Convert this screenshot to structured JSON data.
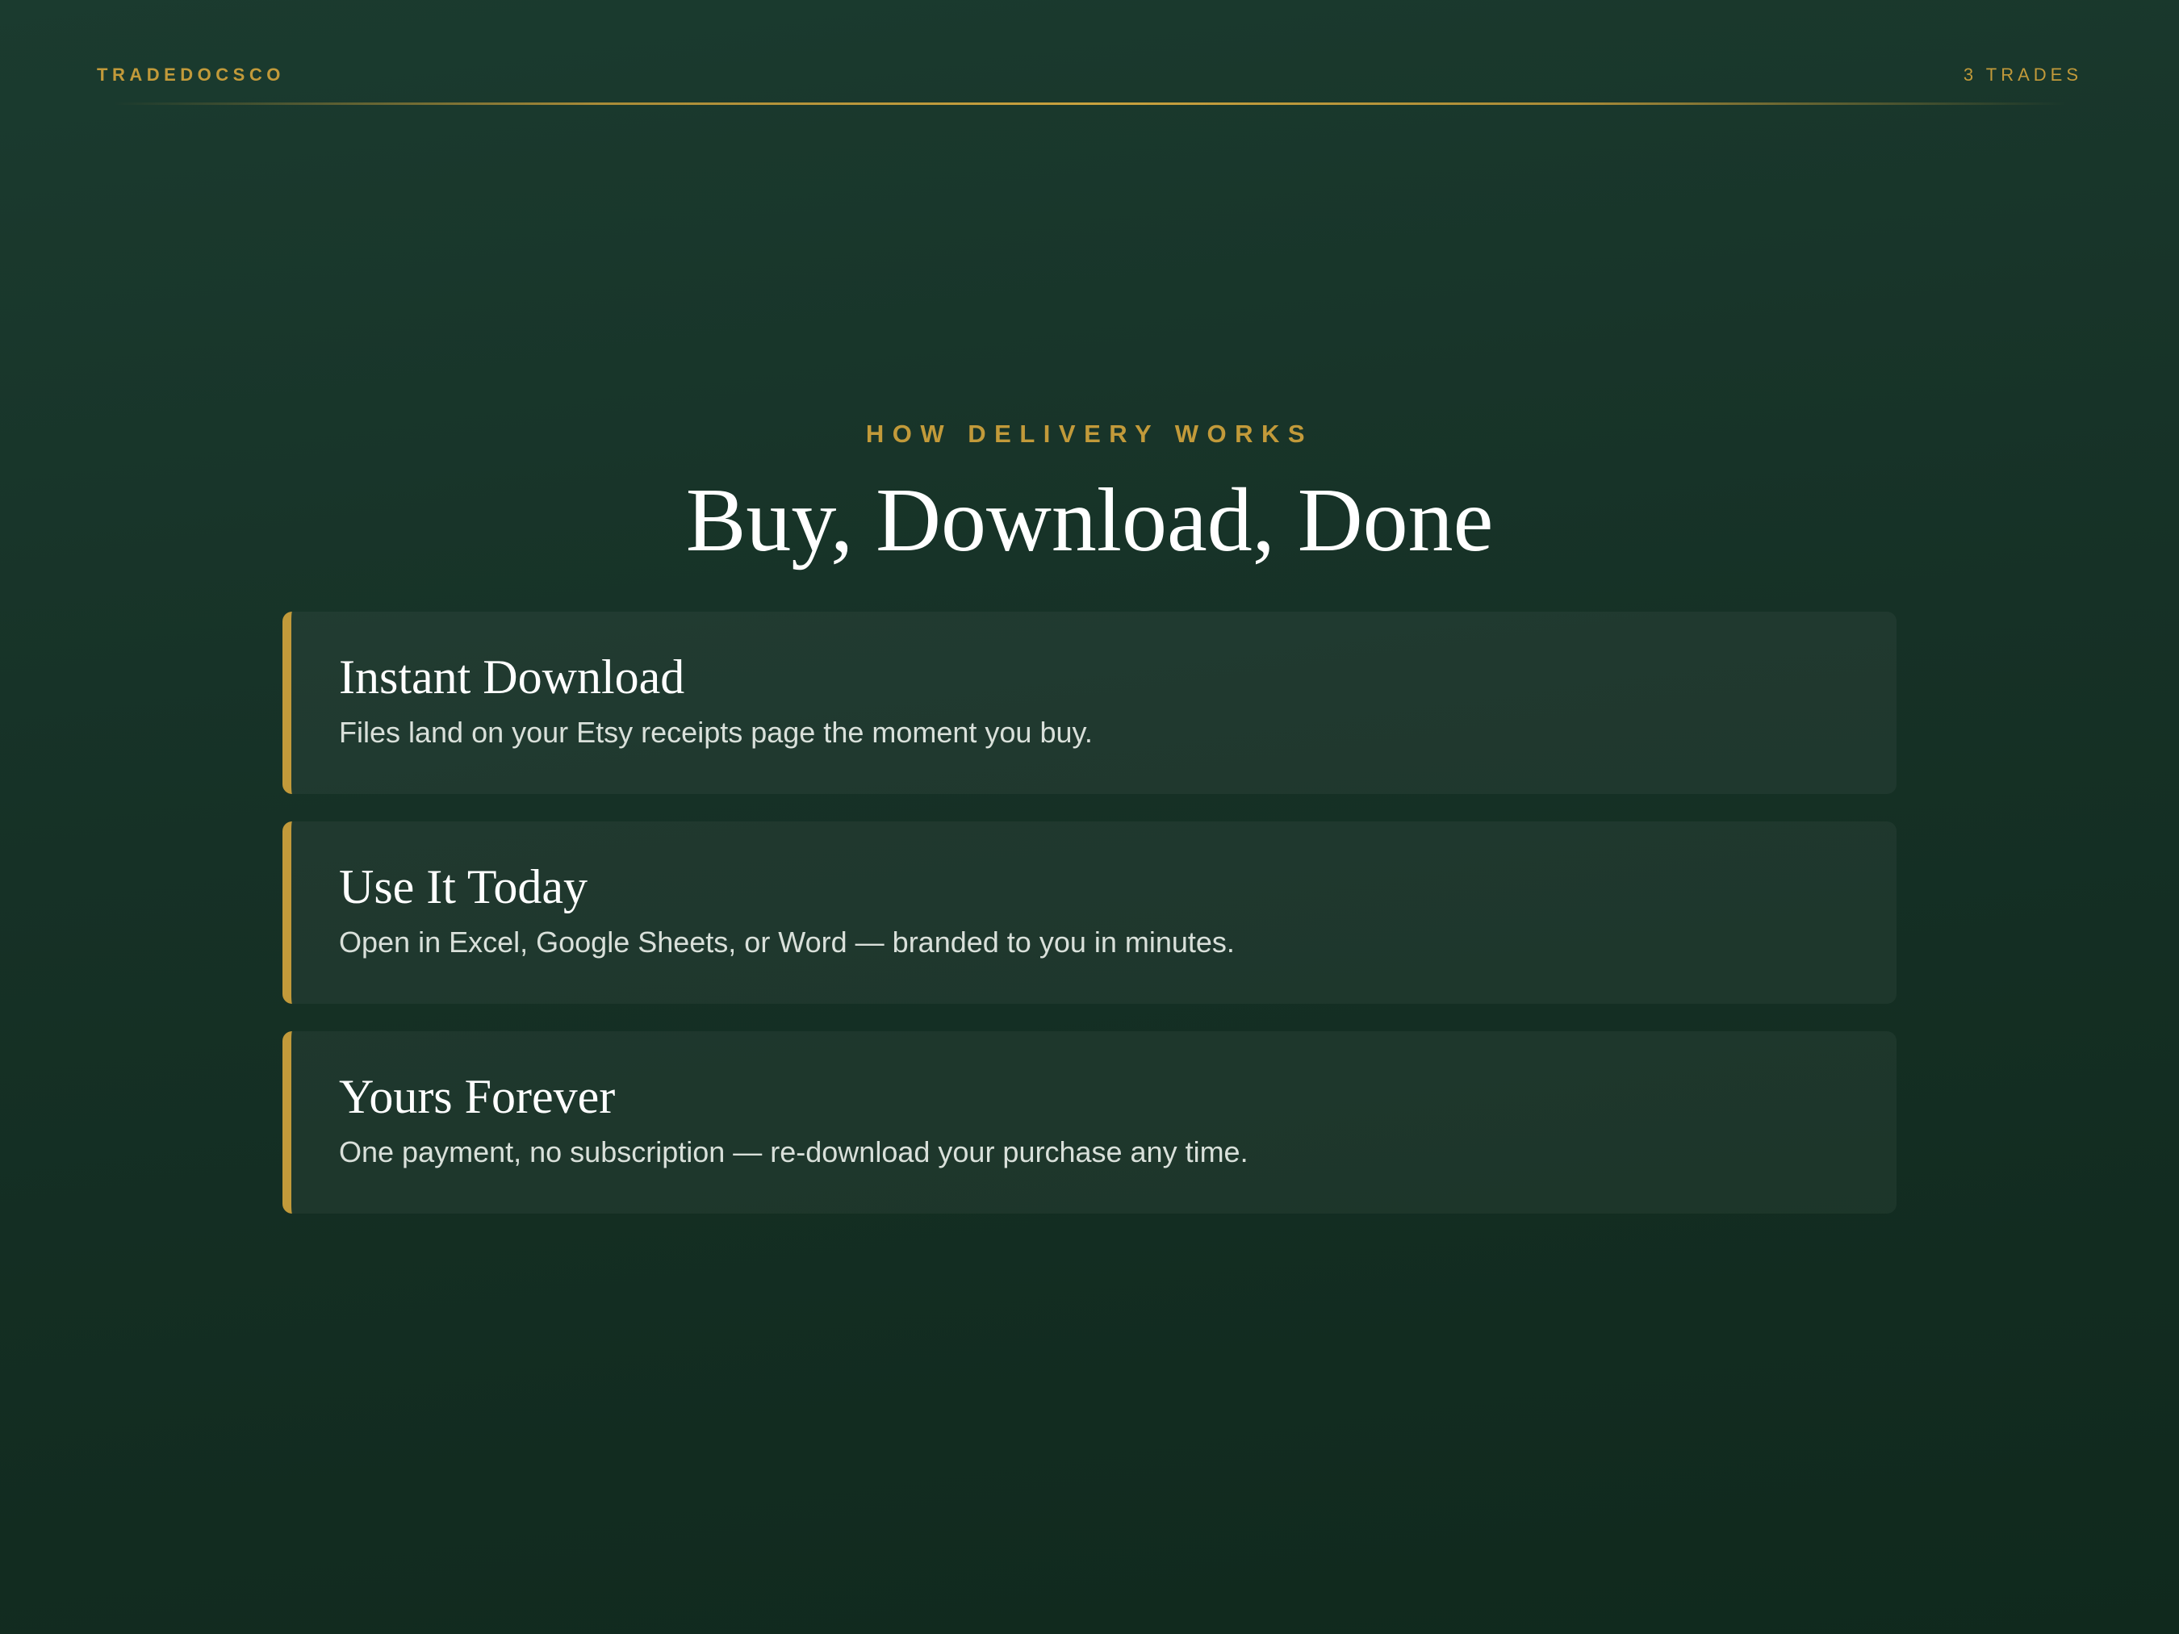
{
  "header": {
    "brand": "TRADEDOCSCO",
    "trade_count": "3 TRADES"
  },
  "section": {
    "eyebrow": "HOW DELIVERY WORKS",
    "title": "Buy, Download, Done"
  },
  "cards": [
    {
      "title": "Instant Download",
      "text": "Files land on your Etsy receipts page the moment you buy."
    },
    {
      "title": "Use It Today",
      "text": "Open in Excel, Google Sheets, or Word — branded to you in minutes."
    },
    {
      "title": "Yours Forever",
      "text": "One payment, no subscription — re-download your purchase any time."
    }
  ],
  "colors": {
    "background": "#163126",
    "accent_gold": "#c29a3a",
    "title_text": "#ffffff",
    "body_text": "#d9e0da"
  }
}
